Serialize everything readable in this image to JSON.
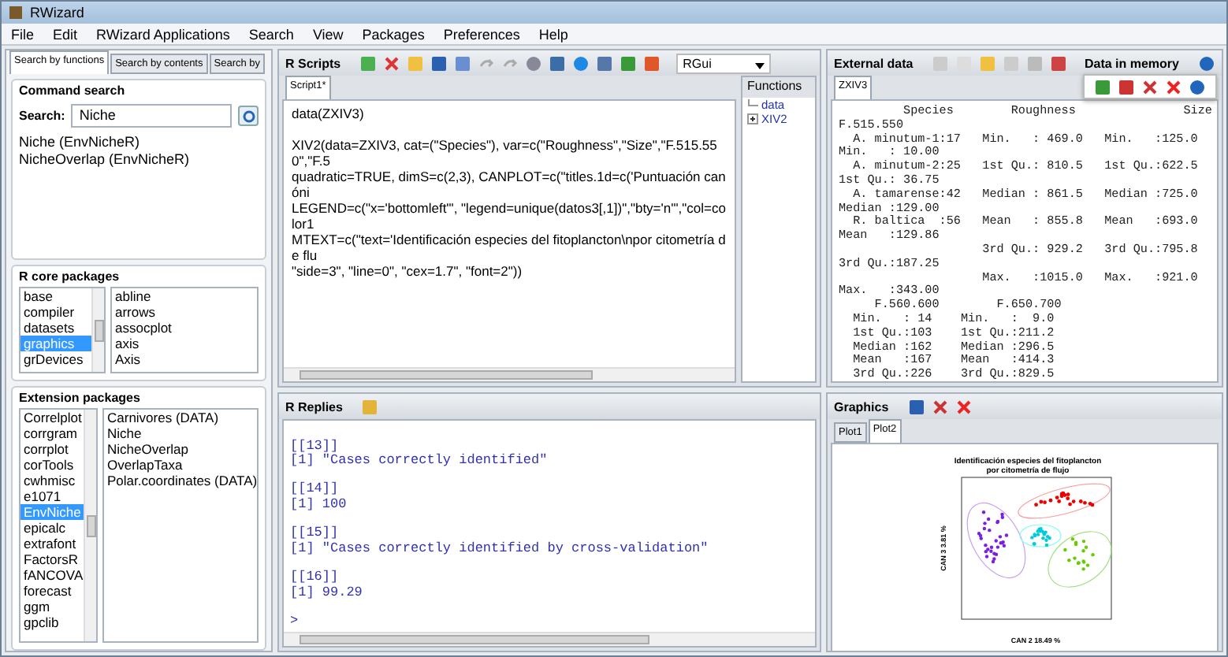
{
  "window": {
    "title": "RWizard"
  },
  "menu": [
    "File",
    "Edit",
    "RWizard Applications",
    "Search",
    "View",
    "Packages",
    "Preferences",
    "Help"
  ],
  "left_panel": {
    "tabs": [
      {
        "label": "Search by functions",
        "selected": true
      },
      {
        "label": "Search by contents",
        "selected": false
      },
      {
        "label": "Search by",
        "selected": false
      }
    ],
    "command_search": {
      "title": "Command search",
      "search_label": "Search:",
      "search_value": "Niche",
      "results": [
        "Niche (EnvNicheR)",
        "NicheOverlap (EnvNicheR)"
      ]
    },
    "core_packages": {
      "title": "R core packages",
      "packages": [
        {
          "label": "base",
          "selected": false
        },
        {
          "label": "compiler",
          "selected": false
        },
        {
          "label": "datasets",
          "selected": false
        },
        {
          "label": "graphics",
          "selected": true
        },
        {
          "label": "grDevices",
          "selected": false
        }
      ],
      "functions": [
        "abline",
        "arrows",
        "assocplot",
        "axis",
        "Axis"
      ]
    },
    "extension_packages": {
      "title": "Extension packages",
      "packages": [
        {
          "label": "Correlplot",
          "selected": false
        },
        {
          "label": "corrgram",
          "selected": false
        },
        {
          "label": "corrplot",
          "selected": false
        },
        {
          "label": "corTools",
          "selected": false
        },
        {
          "label": "cwhmisc",
          "selected": false
        },
        {
          "label": "e1071",
          "selected": false
        },
        {
          "label": "EnvNiche",
          "selected": true
        },
        {
          "label": "epicalc",
          "selected": false
        },
        {
          "label": "extrafont",
          "selected": false
        },
        {
          "label": "FactorsR",
          "selected": false
        },
        {
          "label": "fANCOVA",
          "selected": false
        },
        {
          "label": "forecast",
          "selected": false
        },
        {
          "label": "ggm",
          "selected": false
        },
        {
          "label": "gpclib",
          "selected": false
        }
      ],
      "functions": [
        "Carnivores (DATA)",
        "Niche",
        "NicheOverlap",
        "OverlapTaxa",
        "Polar.coordinates (DATA)"
      ]
    }
  },
  "scripts": {
    "title": "R Scripts",
    "interpreter": "RGui",
    "tabs": [
      {
        "label": "Script1*",
        "selected": true
      }
    ],
    "code": [
      {
        "lines": [
          "data(ZXIV3)"
        ]
      },
      {
        "lines": [
          "XIV2(data=ZXIV3, cat=(\"Species\"), var=c(\"Roughness\",\"Size\",\"F.515.550\",\"F.5",
          "quadratic=TRUE, dimS=c(2,3), CANPLOT=c(\"titles.1d=c('Puntuación canóni",
          "LEGEND=c(\"x='bottomleft'\", \"legend=unique(datos3[,1])\",\"bty='n'\",\"col=color1",
          "MTEXT=c(\"text='Identificación especies del fitoplancton\\npor citometría de flu",
          "\"side=3\", \"line=0\", \"cex=1.7\", \"font=2\"))"
        ]
      }
    ],
    "functions_panel": {
      "title": "Functions",
      "tree": [
        {
          "label": "data"
        },
        {
          "label": "XIV2",
          "expanded": false
        }
      ]
    }
  },
  "external_data": {
    "title": "External data",
    "memory_label": "Data in memory",
    "tabs": [
      {
        "label": "ZXIV3",
        "selected": true
      }
    ],
    "output": [
      "         Species        Roughness               Size",
      "F.515.550",
      "  A. minutum-1:17   Min.   : 469.0   Min.   :125.0",
      "Min.   : 10.00",
      "  A. minutum-2:25   1st Qu.: 810.5   1st Qu.:622.5",
      "1st Qu.: 36.75",
      "  A. tamarense:42   Median : 861.5   Median :725.0",
      "Median :129.00",
      "  R. baltica  :56   Mean   : 855.8   Mean   :693.0",
      "Mean   :129.86",
      "                    3rd Qu.: 929.2   3rd Qu.:795.8",
      "3rd Qu.:187.25",
      "                    Max.   :1015.0   Max.   :921.0",
      "Max.   :343.00",
      "     F.560.600        F.650.700",
      "  Min.   : 14    Min.   :  9.0",
      "  1st Qu.:103    1st Qu.:211.2",
      "  Median :162    Median :296.5",
      "  Mean   :167    Mean   :414.3",
      "  3rd Qu.:226    3rd Qu.:829.5"
    ]
  },
  "replies": {
    "title": "R Replies",
    "output": [
      {
        "lines": [
          "[[13]]",
          "[1] \"Cases correctly identified\""
        ]
      },
      {
        "lines": [
          "[[14]]",
          "[1] 100"
        ]
      },
      {
        "lines": [
          "[[15]]",
          "[1] \"Cases correctly identified by cross-validation\""
        ]
      },
      {
        "lines": [
          "[[16]]",
          "[1] 99.29"
        ]
      },
      {
        "lines": [
          ">"
        ]
      }
    ]
  },
  "graphics": {
    "title": "Graphics",
    "tabs": [
      {
        "label": "Plot1",
        "selected": false
      },
      {
        "label": "Plot2",
        "selected": true
      }
    ],
    "plot": {
      "title": [
        "Identificación especies del fitoplancton",
        "por citometría de flujo"
      ],
      "xlabel": "CAN 2 18.49 %",
      "ylabel": "CAN 3 3.81 %"
    }
  }
}
